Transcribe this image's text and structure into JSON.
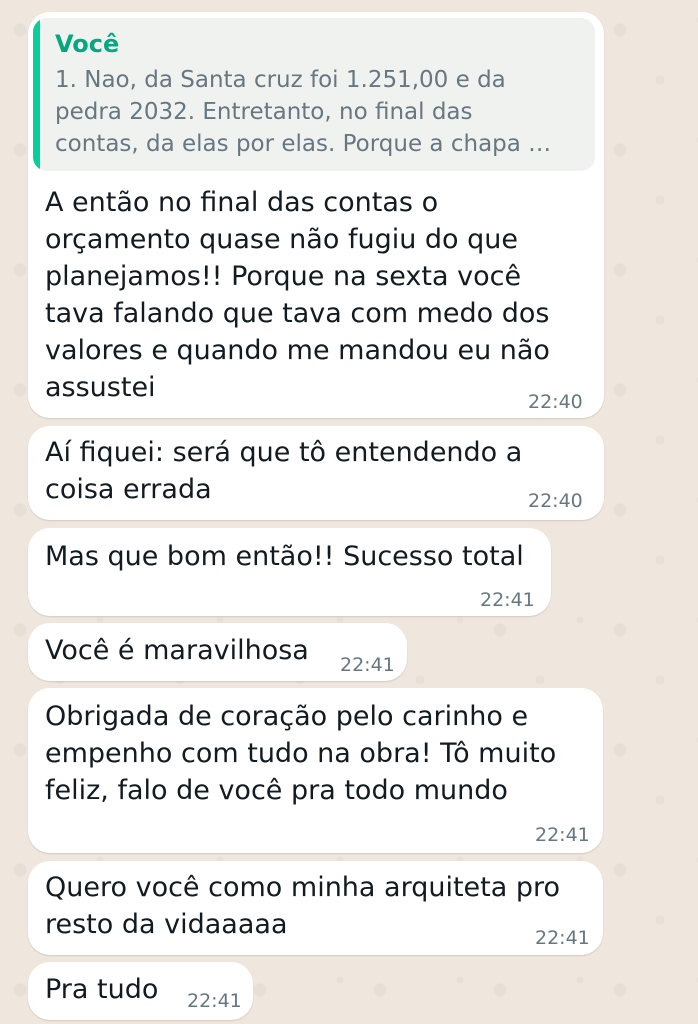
{
  "reply_quote": {
    "author": "Você",
    "text": "1. Nao, da Santa cruz foi 1.251,00 e da\npedra 2032. Entretanto, no final das\ncontas, da elas por elas. Porque a chapa …"
  },
  "messages": [
    {
      "text": "A então no final das contas o\norçamento quase não fugiu do que\nplanejamos!! Porque na sexta você\ntava falando que tava com medo dos\nvalores e quando me mandou eu não\nassustei",
      "time": "22:40"
    },
    {
      "text": "Aí fiquei: será que tô entendendo a\ncoisa errada",
      "time": "22:40"
    },
    {
      "text": "Mas que bom então!! Sucesso total",
      "time": "22:41"
    },
    {
      "text": "Você é maravilhosa",
      "time": "22:41"
    },
    {
      "text": "Obrigada de coração pelo carinho e\nempenho com tudo na obra! Tô muito\nfeliz, falo de você pra todo mundo",
      "time": "22:41"
    },
    {
      "text": "Quero você como minha arquiteta pro\nresto da vidaaaaa",
      "time": "22:41"
    },
    {
      "text": "Pra tudo",
      "time": "22:41"
    }
  ]
}
